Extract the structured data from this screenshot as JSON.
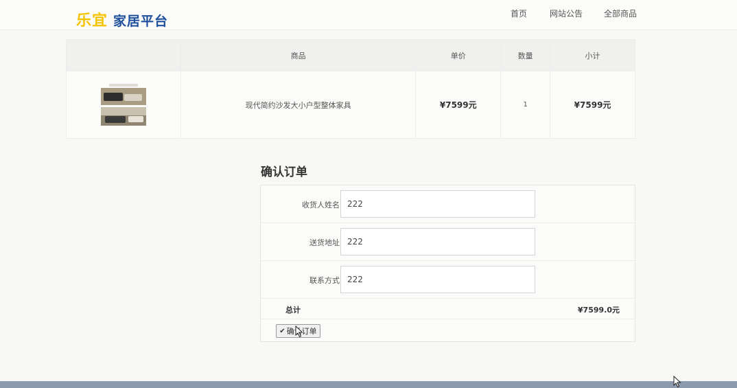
{
  "logo": {
    "brand": "乐宜",
    "subtitle": "家居平台"
  },
  "nav": {
    "home": "首页",
    "notice": "网站公告",
    "all_products": "全部商品"
  },
  "cart": {
    "headers": [
      "",
      "商品",
      "单价",
      "数量",
      "小计"
    ],
    "items": [
      {
        "name": "现代简约沙发大小户型整体家具",
        "price": "¥7599元",
        "quantity": "1",
        "subtotal": "¥7599元"
      }
    ]
  },
  "order": {
    "title": "确认订单",
    "fields": [
      {
        "label": "收货人姓名",
        "value": "222"
      },
      {
        "label": "送货地址",
        "value": "222"
      },
      {
        "label": "联系方式",
        "value": "222"
      }
    ],
    "total_label": "总计",
    "total_value": "¥7599.0元",
    "confirm_button": "确认订单"
  },
  "colors": {
    "brand_yellow": "#f5c400",
    "brand_blue": "#1d4f9c",
    "footer": "#8d99ad"
  },
  "icons": {
    "confirm": "check-icon",
    "pointer": "mouse-cursor-icon"
  }
}
